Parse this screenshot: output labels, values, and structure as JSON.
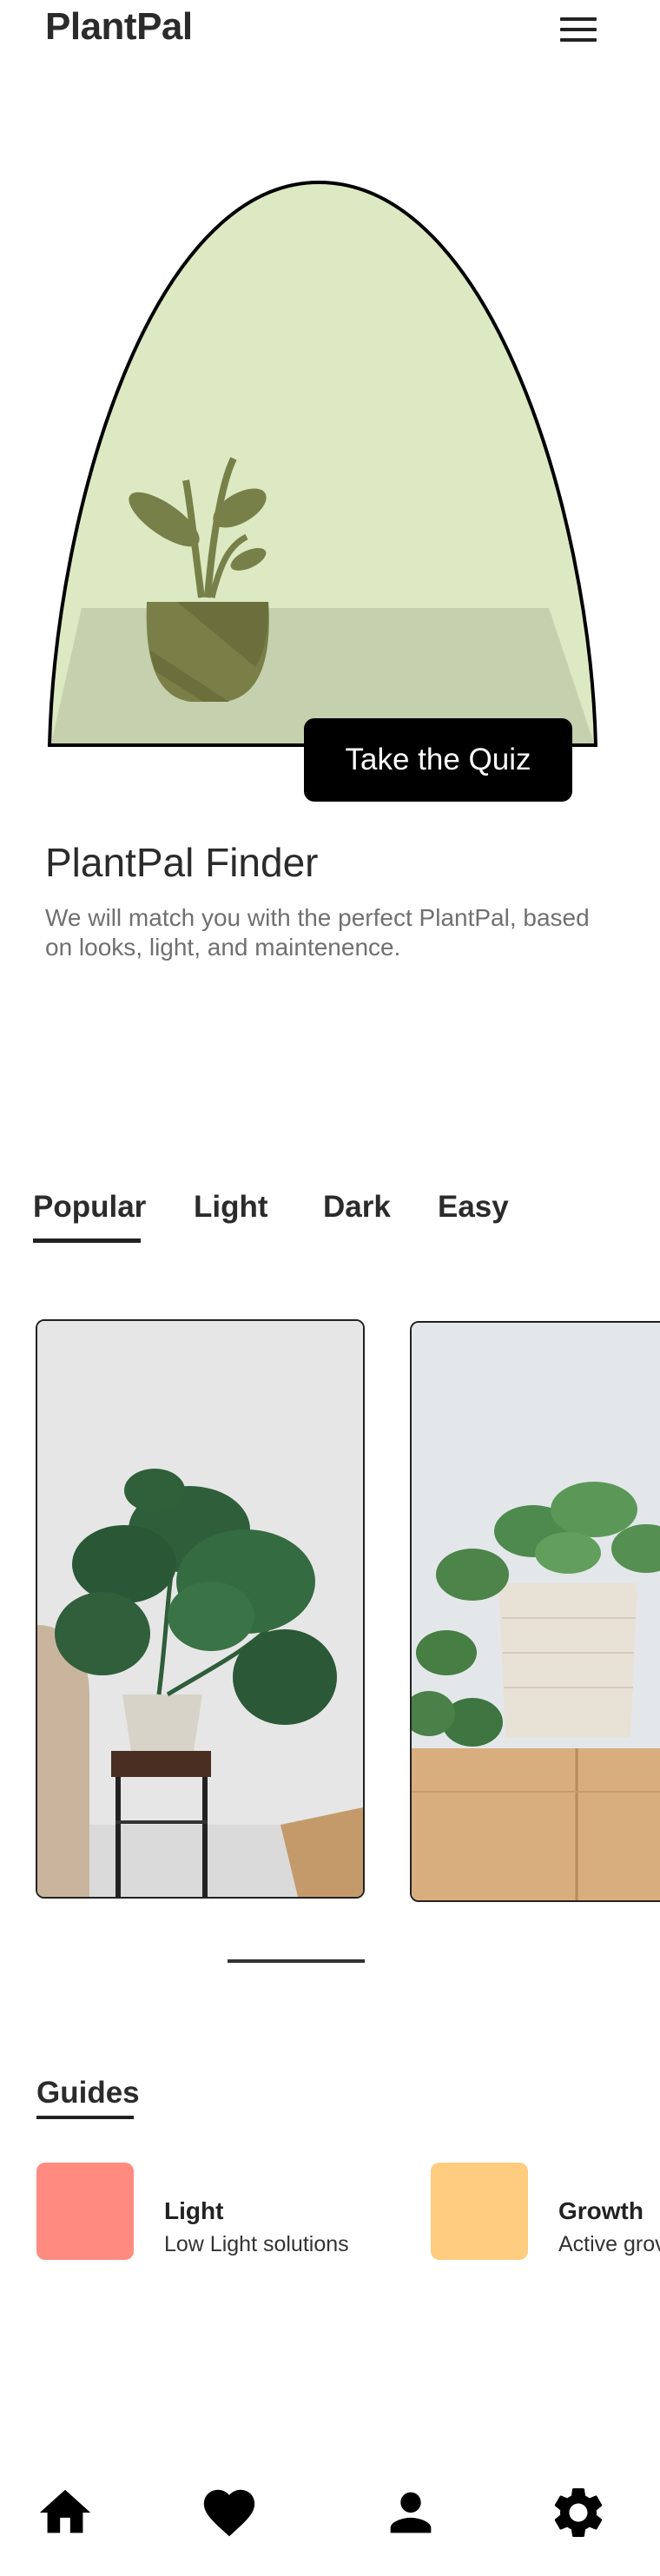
{
  "header": {
    "logo": "PlantPal",
    "menu_icon": "hamburger-menu-icon"
  },
  "hero": {
    "illustration": "potted-plant-illustration",
    "cta_label": "Take the Quiz"
  },
  "finder": {
    "title": "PlantPal Finder",
    "description": "We will match you with the perfect PlantPal, based on looks, light, and maintenence."
  },
  "tabs": [
    {
      "label": "Popular",
      "active": true
    },
    {
      "label": "Light",
      "active": false
    },
    {
      "label": "Dark",
      "active": false
    },
    {
      "label": "Easy",
      "active": false
    }
  ],
  "carousel": {
    "cards": [
      {
        "image": "monstera-plant-photo"
      },
      {
        "image": "pilea-pothos-plant-photo"
      }
    ]
  },
  "guides": {
    "title": "Guides",
    "items": [
      {
        "title": "Light",
        "subtitle": "Low Light solutions",
        "color": "#FF8A80"
      },
      {
        "title": "Growth",
        "subtitle": "Active grov",
        "color": "#FFCC80"
      }
    ]
  },
  "nav": {
    "items": [
      {
        "icon": "home-icon"
      },
      {
        "icon": "heart-icon"
      },
      {
        "icon": "person-icon"
      },
      {
        "icon": "settings-gear-icon"
      }
    ]
  },
  "colors": {
    "hero_bg": "#DCE9C2",
    "hero_table": "#C5D0AE",
    "pot": "#7A7F48",
    "leaf": "#78804A"
  }
}
